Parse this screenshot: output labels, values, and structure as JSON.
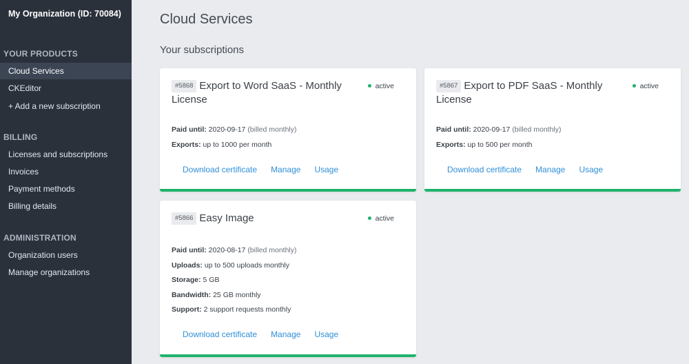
{
  "sidebar": {
    "org_title": "My Organization (ID: 70084)",
    "sections": [
      {
        "title": "YOUR PRODUCTS",
        "items": [
          "Cloud Services",
          "CKEditor",
          "+ Add a new subscription"
        ]
      },
      {
        "title": "BILLING",
        "items": [
          "Licenses and subscriptions",
          "Invoices",
          "Payment methods",
          "Billing details"
        ]
      },
      {
        "title": "ADMINISTRATION",
        "items": [
          "Organization users",
          "Manage organizations"
        ]
      }
    ],
    "active_item": "Cloud Services"
  },
  "main": {
    "title": "Cloud Services",
    "subtitle": "Your subscriptions"
  },
  "cards": [
    {
      "id": "#5868",
      "name": "Export to Word SaaS - Monthly License",
      "status": "active",
      "details": [
        {
          "label": "Paid until",
          "value": "2020-09-17",
          "note": "(billed monthly)"
        },
        {
          "label": "Exports",
          "value": "up to 1000 per month"
        }
      ],
      "actions": [
        "Download certificate",
        "Manage",
        "Usage"
      ]
    },
    {
      "id": "#5867",
      "name": "Export to PDF SaaS - Monthly License",
      "status": "active",
      "details": [
        {
          "label": "Paid until",
          "value": "2020-09-17",
          "note": "(billed monthly)"
        },
        {
          "label": "Exports",
          "value": "up to 500 per month"
        }
      ],
      "actions": [
        "Download certificate",
        "Manage",
        "Usage"
      ]
    },
    {
      "id": "#5866",
      "name": "Easy Image",
      "status": "active",
      "details": [
        {
          "label": "Paid until",
          "value": "2020-08-17",
          "note": "(billed monthly)"
        },
        {
          "label": "Uploads",
          "value": "up to 500 uploads monthly"
        },
        {
          "label": "Storage",
          "value": "5 GB"
        },
        {
          "label": "Bandwidth",
          "value": "25 GB monthly"
        },
        {
          "label": "Support",
          "value": "2 support requests monthly"
        }
      ],
      "actions": [
        "Download certificate",
        "Manage",
        "Usage"
      ]
    }
  ],
  "colors": {
    "sidebar_bg": "#2b313b",
    "active_item_bg": "#3b4554",
    "page_bg": "#e9ebee",
    "link": "#2e8fd8",
    "active_status": "#1fb36b"
  }
}
